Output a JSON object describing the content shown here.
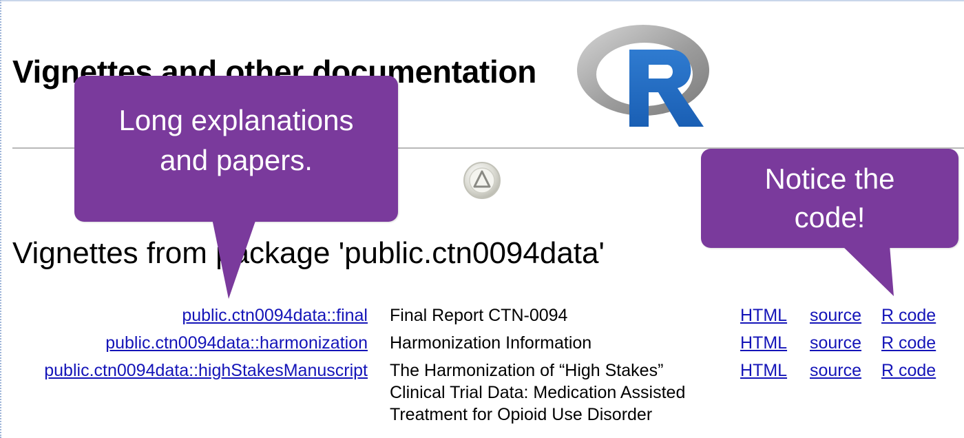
{
  "page": {
    "title": "Vignettes and other documentation",
    "section_heading": "Vignettes from package 'public.ctn0094data'"
  },
  "logo": {
    "letter": "R",
    "ring_color": "#9a9a9a",
    "letter_color": "#1f67c0"
  },
  "up_icon": {
    "icon": "up-arrow-icon"
  },
  "vignettes": [
    {
      "name": "public.ctn0094data::final",
      "title": [
        "Final Report CTN-0094"
      ],
      "links": {
        "html": "HTML",
        "source": "source",
        "rcode": "R code"
      }
    },
    {
      "name": "public.ctn0094data::harmonization",
      "title": [
        "Harmonization Information"
      ],
      "links": {
        "html": "HTML",
        "source": "source",
        "rcode": "R code"
      }
    },
    {
      "name": "public.ctn0094data::highStakesManuscript",
      "title": [
        "The Harmonization of “High Stakes”",
        "Clinical Trial Data: Medication Assisted",
        "Treatment for Opioid Use Disorder"
      ],
      "links": {
        "html": "HTML",
        "source": "source",
        "rcode": "R code"
      }
    }
  ],
  "callouts": {
    "left": {
      "line1": "Long explanations",
      "line2": "and papers."
    },
    "right": {
      "line1": "Notice the",
      "line2": "code!"
    },
    "color": "#7a3a9c"
  },
  "colors": {
    "link": "#1414b8"
  }
}
